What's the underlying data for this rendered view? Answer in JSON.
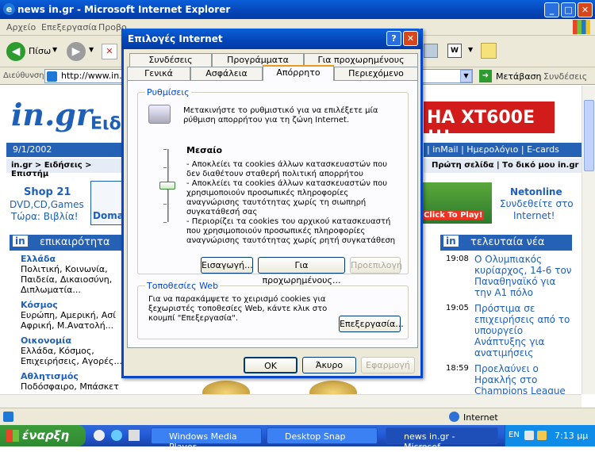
{
  "window": {
    "title": "news in.gr - Microsoft Internet Explorer"
  },
  "menu": [
    "Αρχείο",
    "Επεξεργασία",
    "Προβο"
  ],
  "toolbar": {
    "back_label": "Πίσω"
  },
  "address": {
    "label": "Διεύθυνση",
    "value": "http://www.in.gr",
    "go_label": "Μετάβαση",
    "links_label": "Συνδέσεις"
  },
  "page": {
    "logo": "in.gr",
    "logo_suffix": "Ειδή",
    "date": "9/1/2002",
    "breadcrumb": "in.gr > Ειδήσεις > Επιστήμ",
    "banner": "HA XT600E !!!",
    "nav_top": "| inMail | Ημερολόγιο | E-cards",
    "nav_sub": "Πρώτη σελίδα  | Το δικό μου in.gr",
    "shop": {
      "title": "Shop 21",
      "line1": "DVD,CD,Games",
      "line2": "Τώρα: Βιβλία!"
    },
    "domain_ad": "Doma",
    "play_ad": "Click To Play!",
    "netonline": {
      "title": "Netonline",
      "line1": "Συνδεθείτε στο",
      "line2": "Internet!"
    },
    "left_section": {
      "title": "επικαιρότητα",
      "badge": "in"
    },
    "left_items": [
      {
        "head": "Ελλάδα",
        "text": "Πολιτική, Κοινωνία, Παιδεία, Δικαιοσύνη, Διπλωματία..."
      },
      {
        "head": "Κόσμος",
        "text": "Ευρώπη, Αμερική, Ασί Αφρική, Μ.Ανατολή..."
      },
      {
        "head": "Οικονομία",
        "text": "Ελλάδα, Κόσμος, Επιχειρήσεις, Αγορές..."
      },
      {
        "head": "Αθλητισμός",
        "text": "Ποδόσφαιρο, Μπάσκετ"
      }
    ],
    "right_section": {
      "title": "τελευταία νέα",
      "badge": "in"
    },
    "news": [
      {
        "time": "19:08",
        "text": "Ο Ολυμπιακός κυρίαρχος, 14-6 τον Παναθηναϊκό για την Α1 πόλο"
      },
      {
        "time": "19:05",
        "text": "Πρόστιμα σε επιχειρήσεις από το υπουργείο Ανάπτυξης για ανατιμήσεις"
      },
      {
        "time": "18:59",
        "text": "Προελαύνει ο Ηρακλής στο Champions League βόλεϊ"
      }
    ]
  },
  "statusbar": {
    "zone": "Internet"
  },
  "taskbar": {
    "start": "έναρξη",
    "tasks": [
      "Windows Media Player",
      "Desktop Snap",
      "news in.gr - Microsof..."
    ],
    "lang": "EN",
    "clock": "7:13 μμ"
  },
  "dialog": {
    "title": "Επιλογές Internet",
    "tabs_row1": [
      "Συνδέσεις",
      "Προγράμματα",
      "Για προχωρημένους"
    ],
    "tabs_row2": [
      "Γενικά",
      "Ασφάλεια",
      "Απόρρητο",
      "Περιεχόμενο"
    ],
    "settings": {
      "legend": "Ρυθμίσεις",
      "intro": "Μετακινήστε το ρυθμιστικό για να επιλέξετε μία ρύθμιση απορρήτου για τη ζώνη Internet.",
      "level": "Μεσαίο",
      "slider_level": 0.5,
      "desc": [
        "- Αποκλείει τα cookies άλλων κατασκευαστών που δεν διαθέτουν σταθερή πολιτική απορρήτου",
        "- Αποκλείει τα cookies άλλων κατασκευαστών που χρησιμοποιούν προσωπικές πληροφορίες αναγνώρισης ταυτότητας χωρίς τη σιωπηρή συγκατάθεσή σας",
        "- Περιορίζει τα cookies του αρχικού κατασκευαστή που χρησιμοποιούν προσωπικές πληροφορίες αναγνώρισης ταυτότητας χωρίς ρητή συγκατάθεση"
      ],
      "import_btn": "Εισαγωγή...",
      "advanced_btn": "Για προχωρημένους...",
      "default_btn": "Προεπιλογή"
    },
    "websites": {
      "legend": "Τοποθεσίες Web",
      "text": "Για να παρακάμψετε το χειρισμό cookies για ξεχωριστές τοποθεσίες Web, κάντε κλικ στο κουμπί \"Επεξεργασία\".",
      "edit_btn": "Επεξεργασία..."
    },
    "ok": "OK",
    "cancel": "Άκυρο",
    "apply": "Εφαρμογή"
  }
}
